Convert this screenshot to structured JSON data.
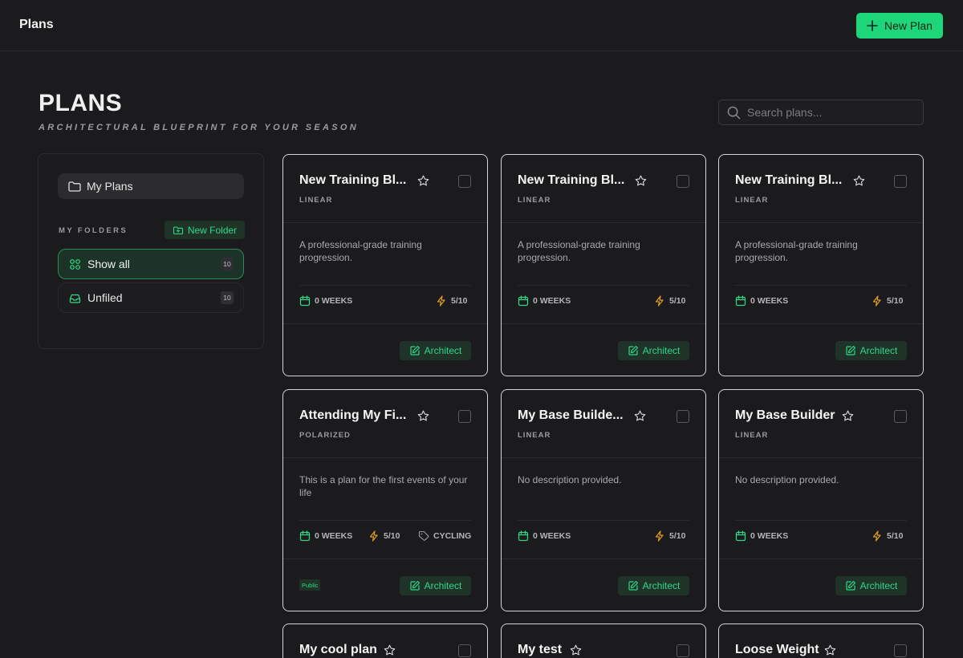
{
  "topbar": {
    "title": "Plans",
    "new_plan_label": "New Plan"
  },
  "header": {
    "title": "PLANS",
    "subtitle": "ARCHITECTURAL BLUEPRINT FOR YOUR SEASON",
    "search_placeholder": "Search plans..."
  },
  "sidebar": {
    "my_plans_label": "My Plans",
    "folders_label": "MY FOLDERS",
    "new_folder_label": "New Folder",
    "folders": [
      {
        "label": "Show all",
        "count": "10"
      },
      {
        "label": "Unfiled",
        "count": "10"
      }
    ]
  },
  "cards": [
    {
      "title": "New Training Bl...",
      "type": "LINEAR",
      "description": "A professional-grade training progression.",
      "weeks": "0 WEEKS",
      "intensity": "5/10",
      "action": "Architect"
    },
    {
      "title": "New Training Bl...",
      "type": "LINEAR",
      "description": "A professional-grade training progression.",
      "weeks": "0 WEEKS",
      "intensity": "5/10",
      "action": "Architect"
    },
    {
      "title": "New Training Bl...",
      "type": "LINEAR",
      "description": "A professional-grade training progression.",
      "weeks": "0 WEEKS",
      "intensity": "5/10",
      "action": "Architect"
    },
    {
      "title": "Attending My Fi...",
      "type": "POLARIZED",
      "description": "This is a plan for the first events of your life",
      "weeks": "0 WEEKS",
      "intensity": "5/10",
      "sport": "CYCLING",
      "badge": "Public",
      "action": "Architect"
    },
    {
      "title": "My Base Builde...",
      "type": "LINEAR",
      "description": "No description provided.",
      "weeks": "0 WEEKS",
      "intensity": "5/10",
      "action": "Architect"
    },
    {
      "title": "My Base Builder",
      "type": "LINEAR",
      "description": "No description provided.",
      "weeks": "0 WEEKS",
      "intensity": "5/10",
      "action": "Architect"
    },
    {
      "title": "My cool plan"
    },
    {
      "title": "My test"
    },
    {
      "title": "Loose Weight"
    }
  ],
  "colors": {
    "accent": "#1ed67a",
    "accent_text": "#2fd987",
    "intensity": "#e0a020"
  }
}
